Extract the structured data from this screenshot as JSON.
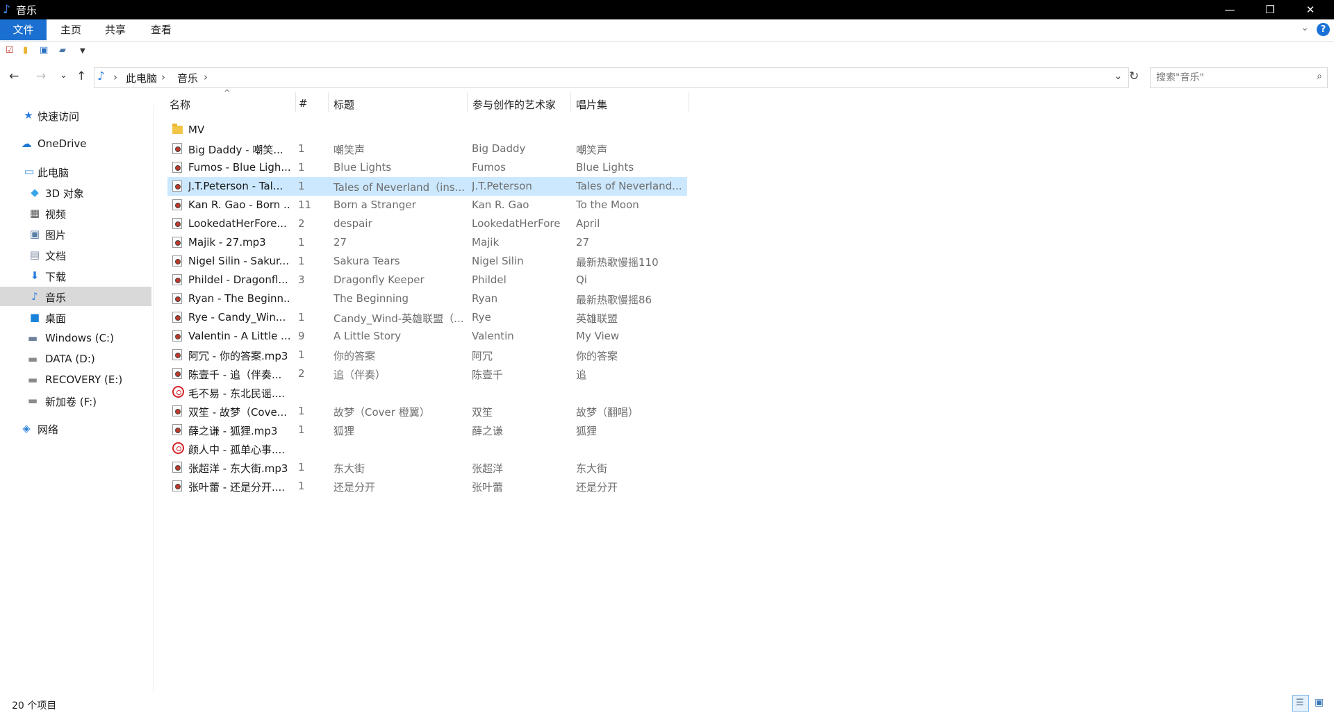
{
  "window": {
    "title": "音乐",
    "minimize": "—",
    "restore": "❐",
    "close": "✕"
  },
  "ribbon": {
    "tabs": [
      "文件",
      "主页",
      "共享",
      "查看"
    ],
    "expand_icon": "chevron-down-icon",
    "help_label": "?"
  },
  "address": {
    "back": "←",
    "forward": "→",
    "recent": "⌄",
    "up": "↑",
    "crumbs": [
      "此电脑",
      "音乐"
    ],
    "separator": "›",
    "dropdown": "⌄",
    "refresh": "↻"
  },
  "search": {
    "placeholder": "搜索\"音乐\""
  },
  "sidebar": {
    "items": [
      {
        "label": "快速访问",
        "icon": "star-icon",
        "glyph": "★",
        "color": "#2b7de0"
      },
      {
        "label": "OneDrive",
        "icon": "cloud-icon",
        "glyph": "☁",
        "color": "#1f78d1"
      },
      {
        "label": "此电脑",
        "icon": "computer-icon",
        "glyph": "▭",
        "color": "#2a8ad8"
      },
      {
        "label": "3D 对象",
        "icon": "cube-icon",
        "glyph": "◆",
        "color": "#37a6e6"
      },
      {
        "label": "视频",
        "icon": "film-icon",
        "glyph": "▦",
        "color": "#555"
      },
      {
        "label": "图片",
        "icon": "picture-icon",
        "glyph": "▣",
        "color": "#5a7fa5"
      },
      {
        "label": "文档",
        "icon": "document-icon",
        "glyph": "▤",
        "color": "#7d8ba0"
      },
      {
        "label": "下载",
        "icon": "download-icon",
        "glyph": "⬇",
        "color": "#2b7de0"
      },
      {
        "label": "音乐",
        "icon": "music-note-icon",
        "glyph": "♪",
        "color": "#2b7de0"
      },
      {
        "label": "桌面",
        "icon": "desktop-icon",
        "glyph": "■",
        "color": "#1a82d8"
      },
      {
        "label": "Windows (C:)",
        "icon": "windows-drive-icon",
        "glyph": "▬",
        "color": "#6a7f99"
      },
      {
        "label": "DATA (D:)",
        "icon": "drive-icon",
        "glyph": "▬",
        "color": "#8a8a8a"
      },
      {
        "label": "RECOVERY (E:)",
        "icon": "drive-icon",
        "glyph": "▬",
        "color": "#8a8a8a"
      },
      {
        "label": "新加卷 (F:)",
        "icon": "drive-icon",
        "glyph": "▬",
        "color": "#8a8a8a"
      },
      {
        "label": "网络",
        "icon": "network-icon",
        "glyph": "◈",
        "color": "#2f82d6"
      }
    ],
    "selected": "音乐"
  },
  "columns": {
    "name": "名称",
    "num": "#",
    "title": "标题",
    "artist": "参与创作的艺术家",
    "album": "唱片集"
  },
  "files": [
    {
      "type": "folder",
      "name": "MV",
      "num": "",
      "title": "",
      "artist": "",
      "album": ""
    },
    {
      "type": "audio",
      "name": "Big Daddy - 嘲笑...",
      "num": "1",
      "title": "嘲笑声",
      "artist": "Big Daddy",
      "album": "嘲笑声"
    },
    {
      "type": "audio",
      "name": "Fumos - Blue Ligh...",
      "num": "1",
      "title": "Blue Lights",
      "artist": "Fumos",
      "album": "Blue Lights"
    },
    {
      "type": "audio",
      "name": "J.T.Peterson - Tal...",
      "num": "1",
      "title": "Tales of Neverland（ins...",
      "artist": "J.T.Peterson",
      "album": "Tales of Neverland...",
      "selected": true
    },
    {
      "type": "audio",
      "name": "Kan R. Gao - Born ...",
      "num": "11",
      "title": "Born a Stranger",
      "artist": "Kan R. Gao",
      "album": "To the Moon"
    },
    {
      "type": "audio",
      "name": "LookedatHerFore...",
      "num": "2",
      "title": "despair",
      "artist": "LookedatHerFore",
      "album": "April"
    },
    {
      "type": "audio",
      "name": "Majik - 27.mp3",
      "num": "1",
      "title": "27",
      "artist": "Majik",
      "album": "27"
    },
    {
      "type": "audio",
      "name": "Nigel Silin - Sakur...",
      "num": "1",
      "title": "Sakura Tears",
      "artist": "Nigel Silin",
      "album": "最新热歌慢摇110"
    },
    {
      "type": "audio",
      "name": "Phildel - Dragonfl...",
      "num": "3",
      "title": "Dragonfly Keeper",
      "artist": "Phildel",
      "album": "Qi"
    },
    {
      "type": "audio",
      "name": "Ryan - The Beginn...",
      "num": "",
      "title": "The Beginning",
      "artist": "Ryan",
      "album": "最新热歌慢摇86"
    },
    {
      "type": "audio",
      "name": "Rye - Candy_Win...",
      "num": "1",
      "title": "Candy_Wind-英雄联盟（...",
      "artist": "Rye",
      "album": "英雄联盟"
    },
    {
      "type": "audio",
      "name": "Valentin - A Little ...",
      "num": "9",
      "title": "A Little Story",
      "artist": "Valentin",
      "album": "My View"
    },
    {
      "type": "audio",
      "name": "阿冗 - 你的答案.mp3",
      "num": "1",
      "title": "你的答案",
      "artist": "阿冗",
      "album": "你的答案"
    },
    {
      "type": "audio",
      "name": "陈壹千 - 追（伴奏...",
      "num": "2",
      "title": "追（伴奏）",
      "artist": "陈壹千",
      "album": "追"
    },
    {
      "type": "netease",
      "name": "毛不易 - 东北民谣....",
      "num": "",
      "title": "",
      "artist": "",
      "album": ""
    },
    {
      "type": "audio",
      "name": "双笙 - 故梦（Cove...",
      "num": "1",
      "title": "故梦（Cover 橙翼）",
      "artist": "双笙",
      "album": "故梦（翻唱）"
    },
    {
      "type": "audio",
      "name": "薛之谦 - 狐狸.mp3",
      "num": "1",
      "title": "狐狸",
      "artist": "薛之谦",
      "album": "狐狸"
    },
    {
      "type": "netease",
      "name": "颜人中 - 孤单心事....",
      "num": "",
      "title": "",
      "artist": "",
      "album": ""
    },
    {
      "type": "audio",
      "name": "张超洋 - 东大街.mp3",
      "num": "1",
      "title": "东大街",
      "artist": "张超洋",
      "album": "东大街"
    },
    {
      "type": "audio",
      "name": "张叶蕾 - 还是分开....",
      "num": "1",
      "title": "还是分开",
      "artist": "张叶蕾",
      "album": "还是分开"
    }
  ],
  "status": {
    "count": "20 个项目"
  },
  "colors": {
    "accent": "#1a6fd0",
    "selection": "#cce8ff",
    "nav_selected": "#d9d9d9"
  }
}
